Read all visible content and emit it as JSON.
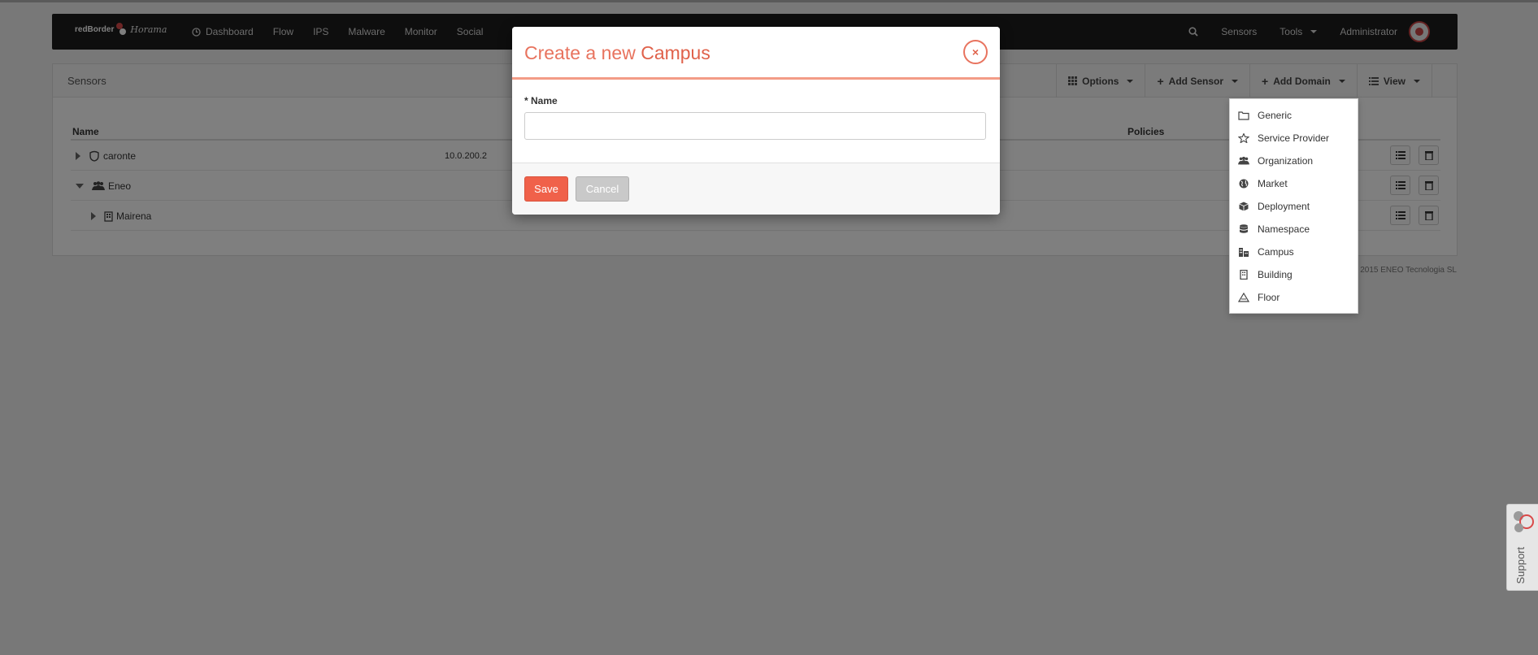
{
  "navbar": {
    "brand_text": "redBorder",
    "brand_script": "Horama",
    "items": [
      {
        "label": "Dashboard",
        "icon": "dashboard-icon"
      },
      {
        "label": "Flow"
      },
      {
        "label": "IPS"
      },
      {
        "label": "Malware"
      },
      {
        "label": "Monitor"
      },
      {
        "label": "Social"
      }
    ],
    "right": {
      "sensors": "Sensors",
      "tools": "Tools",
      "user": "Administrator"
    }
  },
  "panel": {
    "title": "Sensors",
    "tools": {
      "options": "Options",
      "add_sensor": "Add Sensor",
      "add_domain": "Add Domain",
      "view": "View"
    },
    "columns": {
      "name": "Name",
      "policies": "Policies"
    },
    "rows": [
      {
        "name": "caronte",
        "ip": "10.0.200.2",
        "icon": "shield-icon",
        "expanded": false
      },
      {
        "name": "Eneo",
        "ip": "",
        "icon": "organization-icon",
        "expanded": true
      },
      {
        "name": "Mairena",
        "ip": "",
        "icon": "building-icon",
        "expanded": false
      }
    ]
  },
  "copyright": "2015 ENEO Tecnologia SL",
  "add_domain_menu": [
    {
      "label": "Generic",
      "icon": "folder-icon"
    },
    {
      "label": "Service Provider",
      "icon": "star-icon"
    },
    {
      "label": "Organization",
      "icon": "users-icon"
    },
    {
      "label": "Market",
      "icon": "globe-icon"
    },
    {
      "label": "Deployment",
      "icon": "cube-icon"
    },
    {
      "label": "Namespace",
      "icon": "database-icon"
    },
    {
      "label": "Campus",
      "icon": "campus-icon"
    },
    {
      "label": "Building",
      "icon": "building-icon"
    },
    {
      "label": "Floor",
      "icon": "floor-icon"
    }
  ],
  "modal": {
    "title_prefix": "Create a new",
    "title_entity": "Campus",
    "close_label": "×",
    "field": {
      "required_mark": "*",
      "label": "Name",
      "value": ""
    },
    "save": "Save",
    "cancel": "Cancel"
  },
  "support": {
    "label": "Support"
  },
  "colors": {
    "accent": "#f0614a",
    "navbar": "#1c1c1c"
  }
}
